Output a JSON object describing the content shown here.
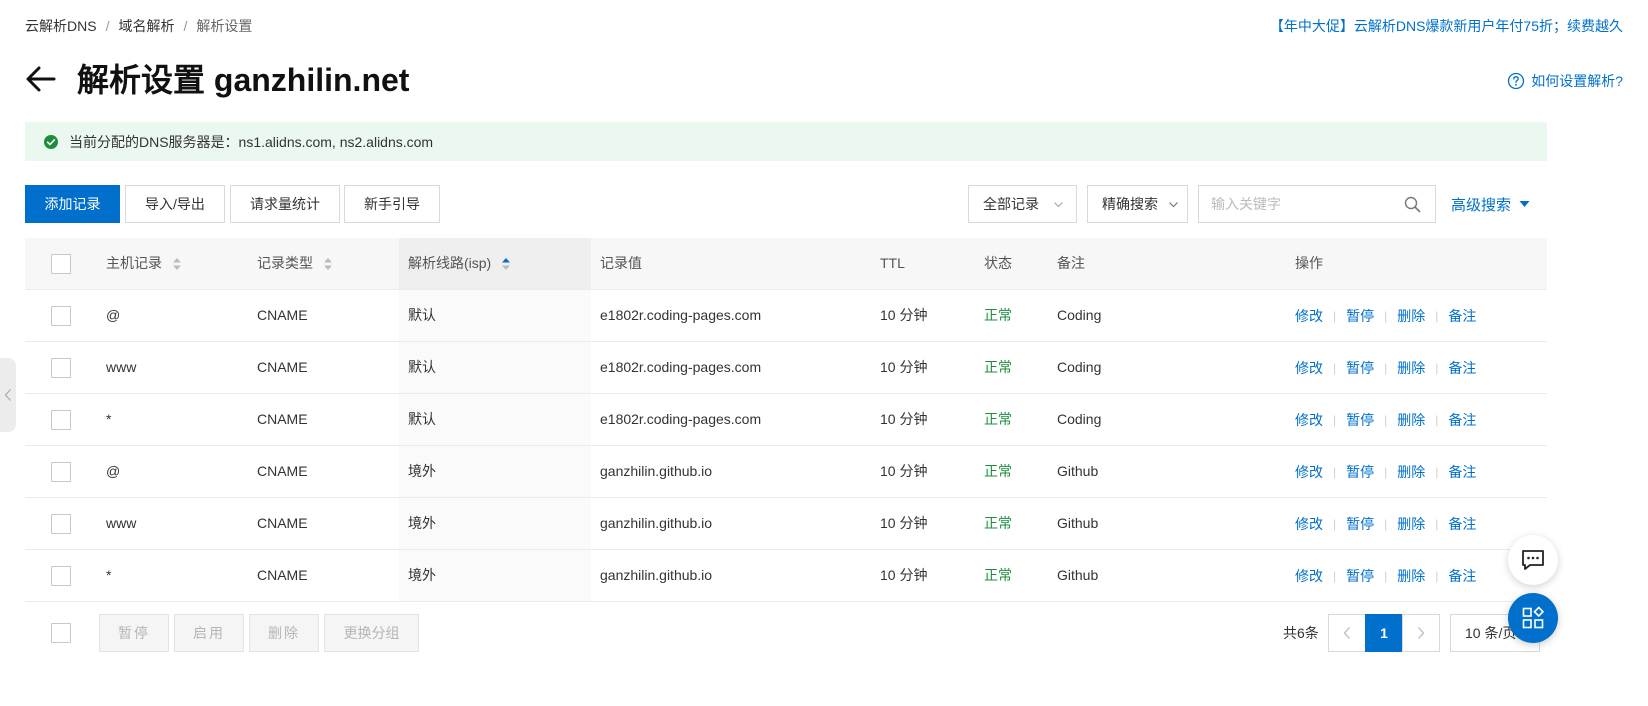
{
  "breadcrumb": {
    "items": [
      "云解析DNS",
      "域名解析",
      "解析设置"
    ],
    "separator": "/"
  },
  "promo": "【年中大促】云解析DNS爆款新用户年付75折；续费越久",
  "title": "解析设置 ganzhilin.net",
  "help_link": "如何设置解析?",
  "notice": "当前分配的DNS服务器是：ns1.alidns.com, ns2.alidns.com",
  "toolbar": {
    "add": "添加记录",
    "import_export": "导入/导出",
    "stats": "请求量统计",
    "guide": "新手引导",
    "filter_select": "全部记录",
    "search_mode": "精确搜索",
    "search_placeholder": "输入关键字",
    "advanced": "高级搜索"
  },
  "table": {
    "headers": {
      "host": "主机记录",
      "type": "记录类型",
      "line": "解析线路(isp)",
      "value": "记录值",
      "ttl": "TTL",
      "status": "状态",
      "remark": "备注",
      "actions": "操作"
    },
    "rows": [
      {
        "host": "@",
        "type": "CNAME",
        "line": "默认",
        "value": "e1802r.coding-pages.com",
        "ttl": "10 分钟",
        "status": "正常",
        "remark": "Coding"
      },
      {
        "host": "www",
        "type": "CNAME",
        "line": "默认",
        "value": "e1802r.coding-pages.com",
        "ttl": "10 分钟",
        "status": "正常",
        "remark": "Coding"
      },
      {
        "host": "*",
        "type": "CNAME",
        "line": "默认",
        "value": "e1802r.coding-pages.com",
        "ttl": "10 分钟",
        "status": "正常",
        "remark": "Coding"
      },
      {
        "host": "@",
        "type": "CNAME",
        "line": "境外",
        "value": "ganzhilin.github.io",
        "ttl": "10 分钟",
        "status": "正常",
        "remark": "Github"
      },
      {
        "host": "www",
        "type": "CNAME",
        "line": "境外",
        "value": "ganzhilin.github.io",
        "ttl": "10 分钟",
        "status": "正常",
        "remark": "Github"
      },
      {
        "host": "*",
        "type": "CNAME",
        "line": "境外",
        "value": "ganzhilin.github.io",
        "ttl": "10 分钟",
        "status": "正常",
        "remark": "Github"
      }
    ],
    "row_actions": [
      "修改",
      "暂停",
      "删除",
      "备注"
    ]
  },
  "footer": {
    "pause": "暂停",
    "enable": "启用",
    "delete": "删除",
    "change_group": "更换分组",
    "total": "共6条",
    "current_page": "1",
    "page_size": "10 条/页"
  },
  "colors": {
    "primary": "#0070cc",
    "status_ok": "#1e8e3e",
    "notice_bg": "#ebf8ef"
  }
}
